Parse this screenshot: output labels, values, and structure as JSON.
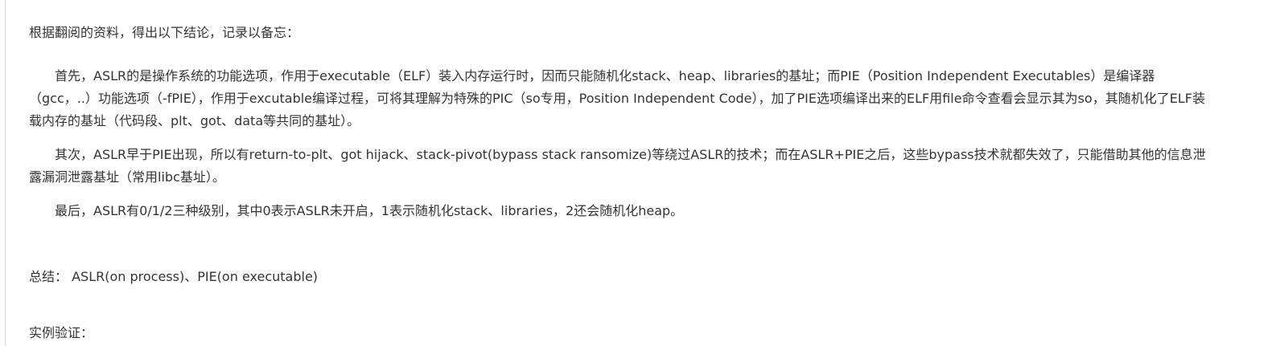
{
  "article": {
    "intro": "根据翻阅的资料，得出以下结论，记录以备忘：",
    "paragraphs": [
      [
        "首先，ASLR的是操作系统的功能选项，作用于executable（ELF）装入内存运行时，因而只能随机化stack、heap、libraries的基址；而PIE（Position Independent Executables）是编译器",
        "（gcc，..）功能选项（-fPIE），作用于excutable编译过程，可将其理解为特殊的PIC（so专用，Position Independent Code），加了PIE选项编译出来的ELF用file命令查看会显示其为so，其随机化了ELF装",
        "载内存的基址（代码段、plt、got、data等共同的基址）。"
      ],
      [
        "其次，ASLR早于PIE出现，所以有return-to-plt、got hijack、stack-pivot(bypass stack ransomize)等绕过ASLR的技术；而在ASLR+PIE之后，这些bypass技术就都失效了，只能借助其他的信息泄",
        "露漏洞泄露基址（常用libc基址）。"
      ],
      [
        "最后，ASLR有0/1/2三种级别，其中0表示ASLR未开启，1表示随机化stack、libraries，2还会随机化heap。"
      ]
    ],
    "summary": "总结： ASLR(on process)、PIE(on executable)",
    "example_heading": "实例验证："
  }
}
